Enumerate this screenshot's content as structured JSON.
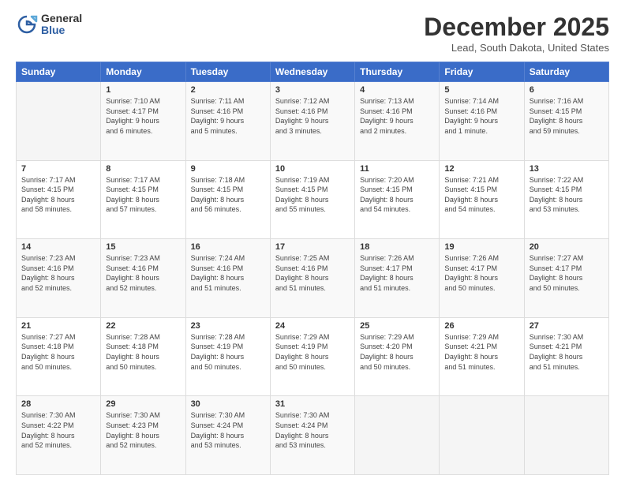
{
  "header": {
    "logo_general": "General",
    "logo_blue": "Blue",
    "month_title": "December 2025",
    "location": "Lead, South Dakota, United States"
  },
  "days_of_week": [
    "Sunday",
    "Monday",
    "Tuesday",
    "Wednesday",
    "Thursday",
    "Friday",
    "Saturday"
  ],
  "weeks": [
    [
      {
        "day": "",
        "info": ""
      },
      {
        "day": "1",
        "info": "Sunrise: 7:10 AM\nSunset: 4:17 PM\nDaylight: 9 hours\nand 6 minutes."
      },
      {
        "day": "2",
        "info": "Sunrise: 7:11 AM\nSunset: 4:16 PM\nDaylight: 9 hours\nand 5 minutes."
      },
      {
        "day": "3",
        "info": "Sunrise: 7:12 AM\nSunset: 4:16 PM\nDaylight: 9 hours\nand 3 minutes."
      },
      {
        "day": "4",
        "info": "Sunrise: 7:13 AM\nSunset: 4:16 PM\nDaylight: 9 hours\nand 2 minutes."
      },
      {
        "day": "5",
        "info": "Sunrise: 7:14 AM\nSunset: 4:16 PM\nDaylight: 9 hours\nand 1 minute."
      },
      {
        "day": "6",
        "info": "Sunrise: 7:16 AM\nSunset: 4:15 PM\nDaylight: 8 hours\nand 59 minutes."
      }
    ],
    [
      {
        "day": "7",
        "info": "Sunrise: 7:17 AM\nSunset: 4:15 PM\nDaylight: 8 hours\nand 58 minutes."
      },
      {
        "day": "8",
        "info": "Sunrise: 7:17 AM\nSunset: 4:15 PM\nDaylight: 8 hours\nand 57 minutes."
      },
      {
        "day": "9",
        "info": "Sunrise: 7:18 AM\nSunset: 4:15 PM\nDaylight: 8 hours\nand 56 minutes."
      },
      {
        "day": "10",
        "info": "Sunrise: 7:19 AM\nSunset: 4:15 PM\nDaylight: 8 hours\nand 55 minutes."
      },
      {
        "day": "11",
        "info": "Sunrise: 7:20 AM\nSunset: 4:15 PM\nDaylight: 8 hours\nand 54 minutes."
      },
      {
        "day": "12",
        "info": "Sunrise: 7:21 AM\nSunset: 4:15 PM\nDaylight: 8 hours\nand 54 minutes."
      },
      {
        "day": "13",
        "info": "Sunrise: 7:22 AM\nSunset: 4:15 PM\nDaylight: 8 hours\nand 53 minutes."
      }
    ],
    [
      {
        "day": "14",
        "info": "Sunrise: 7:23 AM\nSunset: 4:16 PM\nDaylight: 8 hours\nand 52 minutes."
      },
      {
        "day": "15",
        "info": "Sunrise: 7:23 AM\nSunset: 4:16 PM\nDaylight: 8 hours\nand 52 minutes."
      },
      {
        "day": "16",
        "info": "Sunrise: 7:24 AM\nSunset: 4:16 PM\nDaylight: 8 hours\nand 51 minutes."
      },
      {
        "day": "17",
        "info": "Sunrise: 7:25 AM\nSunset: 4:16 PM\nDaylight: 8 hours\nand 51 minutes."
      },
      {
        "day": "18",
        "info": "Sunrise: 7:26 AM\nSunset: 4:17 PM\nDaylight: 8 hours\nand 51 minutes."
      },
      {
        "day": "19",
        "info": "Sunrise: 7:26 AM\nSunset: 4:17 PM\nDaylight: 8 hours\nand 50 minutes."
      },
      {
        "day": "20",
        "info": "Sunrise: 7:27 AM\nSunset: 4:17 PM\nDaylight: 8 hours\nand 50 minutes."
      }
    ],
    [
      {
        "day": "21",
        "info": "Sunrise: 7:27 AM\nSunset: 4:18 PM\nDaylight: 8 hours\nand 50 minutes."
      },
      {
        "day": "22",
        "info": "Sunrise: 7:28 AM\nSunset: 4:18 PM\nDaylight: 8 hours\nand 50 minutes."
      },
      {
        "day": "23",
        "info": "Sunrise: 7:28 AM\nSunset: 4:19 PM\nDaylight: 8 hours\nand 50 minutes."
      },
      {
        "day": "24",
        "info": "Sunrise: 7:29 AM\nSunset: 4:19 PM\nDaylight: 8 hours\nand 50 minutes."
      },
      {
        "day": "25",
        "info": "Sunrise: 7:29 AM\nSunset: 4:20 PM\nDaylight: 8 hours\nand 50 minutes."
      },
      {
        "day": "26",
        "info": "Sunrise: 7:29 AM\nSunset: 4:21 PM\nDaylight: 8 hours\nand 51 minutes."
      },
      {
        "day": "27",
        "info": "Sunrise: 7:30 AM\nSunset: 4:21 PM\nDaylight: 8 hours\nand 51 minutes."
      }
    ],
    [
      {
        "day": "28",
        "info": "Sunrise: 7:30 AM\nSunset: 4:22 PM\nDaylight: 8 hours\nand 52 minutes."
      },
      {
        "day": "29",
        "info": "Sunrise: 7:30 AM\nSunset: 4:23 PM\nDaylight: 8 hours\nand 52 minutes."
      },
      {
        "day": "30",
        "info": "Sunrise: 7:30 AM\nSunset: 4:24 PM\nDaylight: 8 hours\nand 53 minutes."
      },
      {
        "day": "31",
        "info": "Sunrise: 7:30 AM\nSunset: 4:24 PM\nDaylight: 8 hours\nand 53 minutes."
      },
      {
        "day": "",
        "info": ""
      },
      {
        "day": "",
        "info": ""
      },
      {
        "day": "",
        "info": ""
      }
    ]
  ]
}
